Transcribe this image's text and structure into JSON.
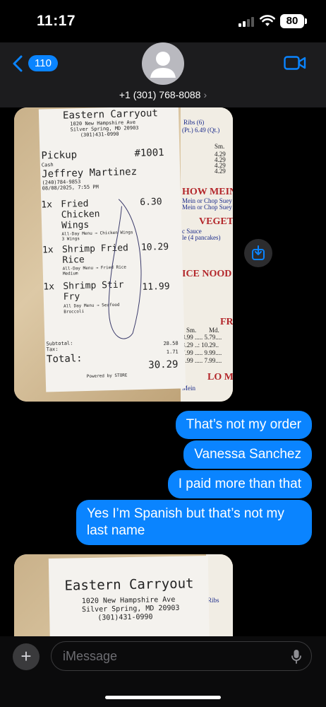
{
  "status": {
    "time": "11:17",
    "battery": "80"
  },
  "header": {
    "back_count": "110",
    "contact": "+1 (301) 768-8088",
    "chevron": "›"
  },
  "receipt1": {
    "restaurant": "Eastern Carryout",
    "addr1": "1020 New Hampshire Ave",
    "addr2": "Silver Spring, MD 20903",
    "phone": "(301)431-0990",
    "order_type": "Pickup",
    "order_no": "#1001",
    "payment": "Cash",
    "customer": "Jeffrey Martinez",
    "cust_phone": "(240)784-9853",
    "datetime": "08/08/2025, 7:55 PM",
    "items": [
      {
        "qty": "1x",
        "name": "Fried",
        "name2": "Chicken",
        "name3": "Wings",
        "price": "6.30",
        "note": "All-Day Menu → Chicken Wings",
        "note2": "3 Wings"
      },
      {
        "qty": "1x",
        "name": "Shrimp Fried",
        "name2": "Rice",
        "price": "10.29",
        "note": "All-Day Menu → Fried Rice",
        "note2": "Medium"
      },
      {
        "qty": "1x",
        "name": "Shrimp Stir",
        "name2": "Fry",
        "price": "11.99",
        "note": "All Day Menu → Seafood",
        "note2": "Broccoli"
      }
    ],
    "subtotal_label": "Subtotal:",
    "subtotal": "28.58",
    "tax_label": "Tax:",
    "tax": "1.71",
    "total_label": "Total:",
    "total": "30.29",
    "powered": "Powered by STORE"
  },
  "menu_board": {
    "ribs": "Ribs (6)",
    "pt_qt": "(Pt.) 6.49 (Qt.)",
    "sm": "Sm.",
    "prices": [
      "4.29",
      "4.29",
      "4.29",
      "4.29",
      "4.29"
    ],
    "h1": "HOW MEIN",
    "h1a": "Mein or Chop Suey",
    "h1b": "Mein or Chop Suey",
    "h2": "VEGET",
    "h2a": "c Sauce",
    "h2b": "le (4 pancakes)",
    "h3": "ICE NOOD",
    "h4": "FR",
    "sm2": "Sm.",
    "md2": "Md.",
    "rows": [
      "3.99 ..... 5.79....",
      "8.29 ..: 10.29..",
      "7.99 ..... 9.99....",
      "5.99 ..... 7.99...."
    ],
    "h5": "LO M",
    "mein": "Mein"
  },
  "messages": [
    "That’s not my order",
    "Vanessa Sanchez",
    "I paid more than that",
    "Yes I’m Spanish but that’s not my last name"
  ],
  "receipt2": {
    "restaurant": "Eastern Carryout",
    "addr1": "1020 New Hampshire Ave",
    "addr2": "Silver Spring, MD 20903",
    "phone": "(301)431-0990",
    "ribs": "Ribs"
  },
  "input": {
    "placeholder": "iMessage",
    "plus": "+"
  },
  "colors": {
    "bubble": "#0a84ff",
    "background": "#000000",
    "header": "#1c1c1e"
  }
}
